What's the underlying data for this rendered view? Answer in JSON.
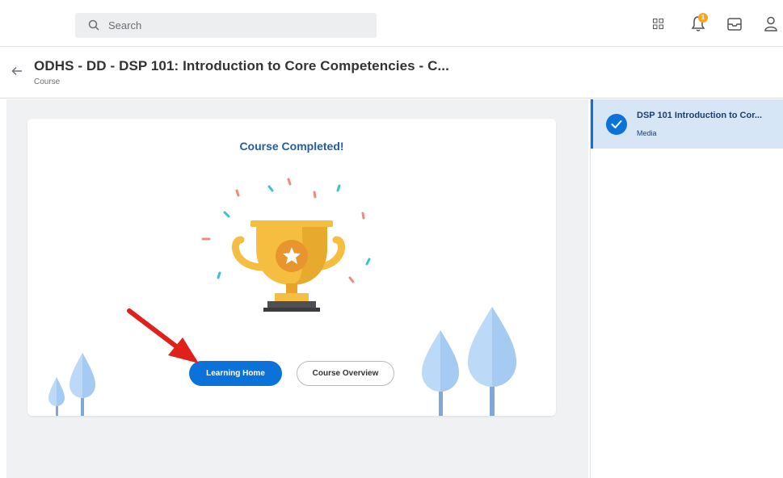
{
  "header": {
    "search_placeholder": "Search",
    "notification_count": "1",
    "icons": [
      "search-icon",
      "apps-grid-icon",
      "bell-icon",
      "inbox-icon",
      "user-icon"
    ]
  },
  "page": {
    "title": "ODHS - DD - DSP 101: Introduction to Core Competencies - C...",
    "subtitle": "Course"
  },
  "card": {
    "title": "Course Completed!",
    "primary_button": "Learning Home",
    "secondary_button": "Course Overview"
  },
  "sidebar": {
    "items": [
      {
        "title": "DSP 101 Introduction to Cor...",
        "type": "Media",
        "status": "completed"
      }
    ]
  },
  "colors": {
    "accent": "#0b72d9",
    "title_blue": "#1f5fa8",
    "trophy": "#f5be41",
    "badge": "#f5a623",
    "annotation_arrow": "#e0201b",
    "selected_bg": "#d7e6f7"
  }
}
